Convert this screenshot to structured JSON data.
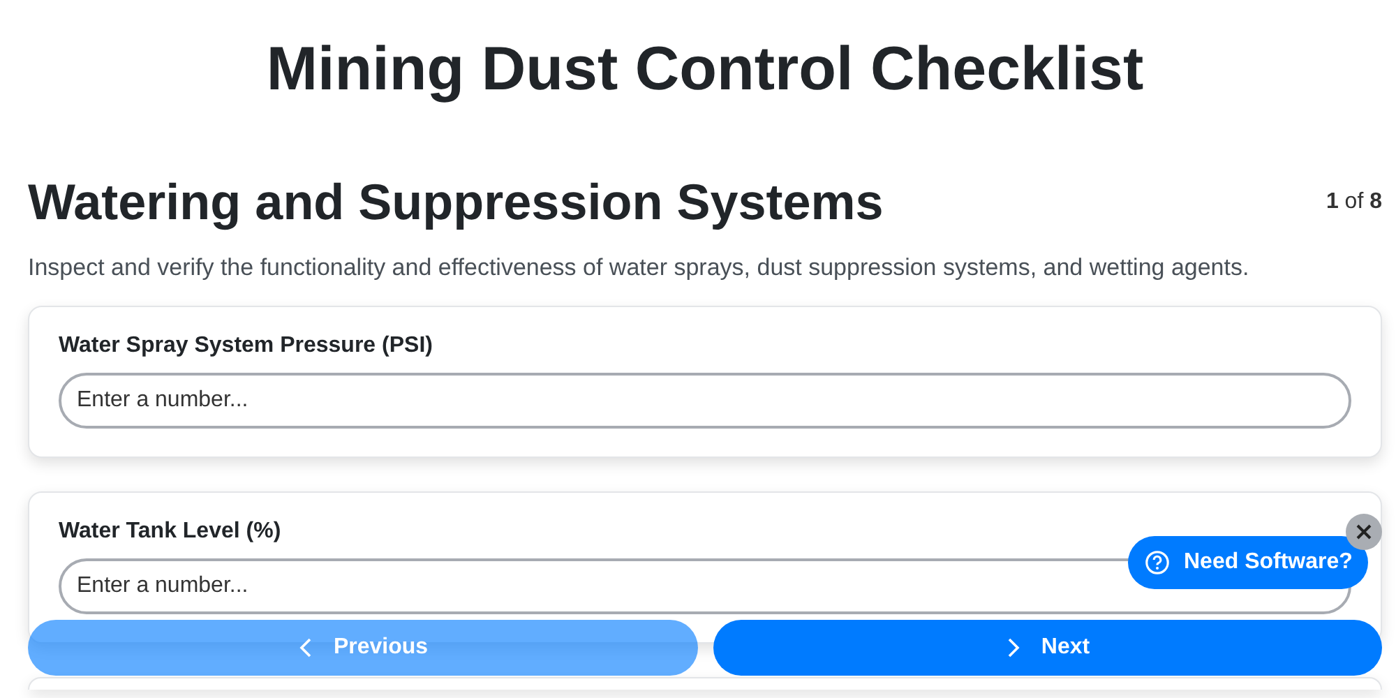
{
  "page_title": "Mining Dust Control Checklist",
  "section": {
    "title": "Watering and Suppression Systems",
    "counter": "**1** of **8**",
    "description": "Inspect and verify the functionality and effectiveness of water sprays, dust suppression systems, and wetting agents."
  },
  "questions": [
    {
      "label": "Water Spray System Pressure (PSI)",
      "placeholder": "Enter a number..."
    },
    {
      "label": "Water Tank Level (%)",
      "placeholder": "Enter a number..."
    }
  ],
  "nav": [
    {
      "kind": "previous",
      "label": "Previous",
      "disabled": true
    },
    {
      "kind": "next",
      "label": "Next",
      "disabled": false
    }
  ],
  "help_widget": {
    "label": "Need Software?"
  }
}
